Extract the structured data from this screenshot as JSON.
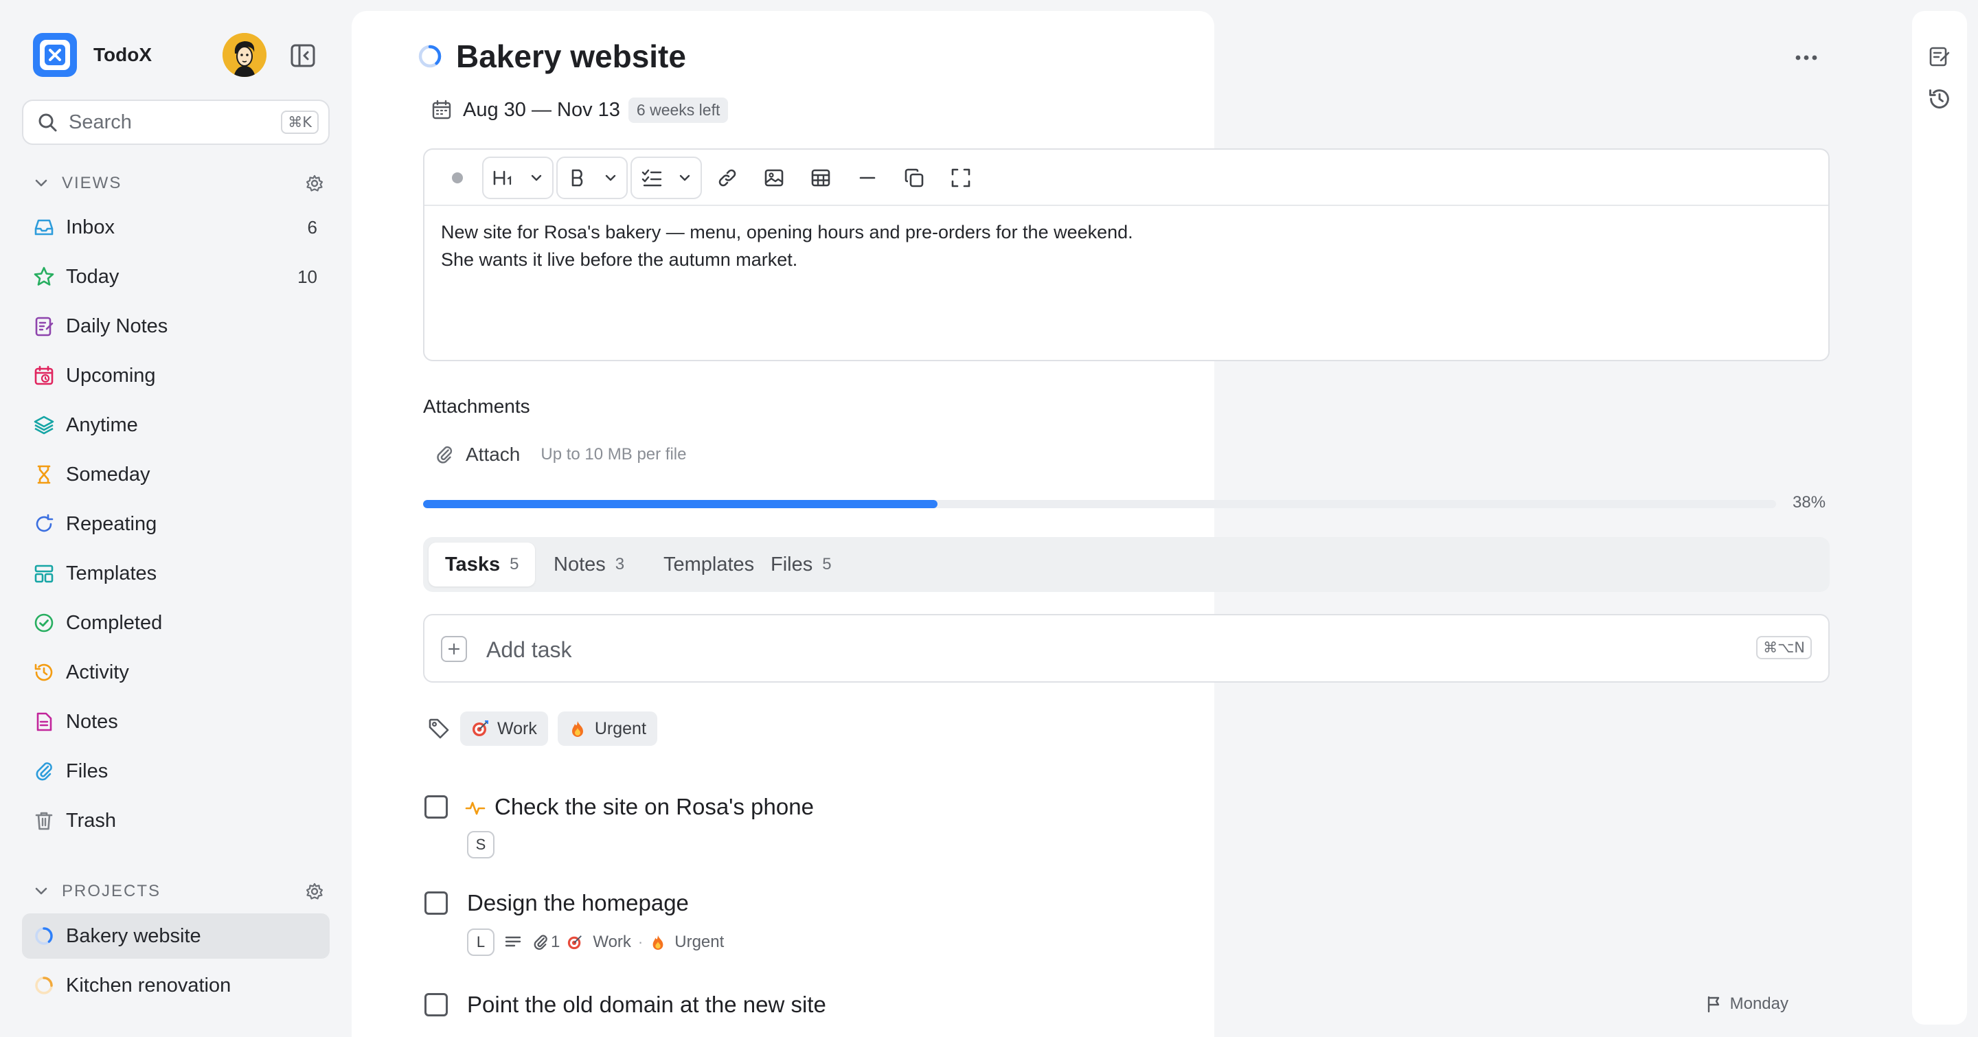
{
  "app": {
    "name": "TodoX"
  },
  "search": {
    "placeholder": "Search",
    "shortcut": "⌘K"
  },
  "sidebar": {
    "views_label": "VIEWS",
    "projects_label": "PROJECTS",
    "views": [
      {
        "label": "Inbox",
        "count": "6",
        "icon": "inbox-icon",
        "color": "#2d9cdb"
      },
      {
        "label": "Today",
        "count": "10",
        "icon": "star-icon",
        "color": "#27ae60"
      },
      {
        "label": "Daily Notes",
        "count": "",
        "icon": "daily-notes-icon",
        "color": "#8e44ad"
      },
      {
        "label": "Upcoming",
        "count": "",
        "icon": "calendar-clock-icon",
        "color": "#e0245e"
      },
      {
        "label": "Anytime",
        "count": "",
        "icon": "layers-icon",
        "color": "#16a5a5"
      },
      {
        "label": "Someday",
        "count": "",
        "icon": "hourglass-icon",
        "color": "#f39c12"
      },
      {
        "label": "Repeating",
        "count": "",
        "icon": "repeat-icon",
        "color": "#3b6fe0"
      },
      {
        "label": "Templates",
        "count": "",
        "icon": "templates-icon",
        "color": "#16a5a5"
      },
      {
        "label": "Completed",
        "count": "",
        "icon": "check-circle-icon",
        "color": "#27ae60"
      },
      {
        "label": "Activity",
        "count": "",
        "icon": "history-icon",
        "color": "#f39c12"
      },
      {
        "label": "Notes",
        "count": "",
        "icon": "note-icon",
        "color": "#c2259b"
      },
      {
        "label": "Files",
        "count": "",
        "icon": "paperclip-icon",
        "color": "#2d9cdb"
      },
      {
        "label": "Trash",
        "count": "",
        "icon": "trash-icon",
        "color": "#7d8187"
      }
    ],
    "projects": [
      {
        "label": "Bakery website",
        "progress": 0.38,
        "color": "#2d7ff9"
      },
      {
        "label": "Kitchen renovation",
        "progress": 0.25,
        "color": "#f2a93b"
      }
    ]
  },
  "project": {
    "title": "Bakery website",
    "progress": 0.38,
    "date_range": "Aug 30 — Nov 13",
    "time_left": "6 weeks left",
    "description": [
      "New site for Rosa's bakery — menu, opening hours and pre-orders for the weekend.",
      "She wants it live before the autumn market."
    ]
  },
  "attachments": {
    "title": "Attachments",
    "attach_label": "Attach",
    "hint": "Up to 10 MB per file",
    "progress_percent": 38,
    "progress_label": "38%"
  },
  "tabs": [
    {
      "label": "Tasks",
      "count": "5"
    },
    {
      "label": "Notes",
      "count": "3"
    },
    {
      "label": "Templates",
      "count": ""
    },
    {
      "label": "Files",
      "count": "5"
    }
  ],
  "add_task": {
    "placeholder": "Add task",
    "shortcut": "⌘⌥N"
  },
  "tags": [
    {
      "label": "Work",
      "icon": "target-icon"
    },
    {
      "label": "Urgent",
      "icon": "fire-icon"
    }
  ],
  "tasks": [
    {
      "title": "Check the site on Rosa's phone",
      "size": "S",
      "has_activity_icon": true
    },
    {
      "title": "Design the homepage",
      "size": "L",
      "attachments": "1",
      "tag_work": "Work",
      "tag_urgent": "Urgent"
    },
    {
      "title": "Point the old domain at the new site",
      "due": "Monday"
    }
  ],
  "colors": {
    "accent": "#2d7ff9",
    "background": "#f4f5f7",
    "panel": "#ffffff"
  }
}
